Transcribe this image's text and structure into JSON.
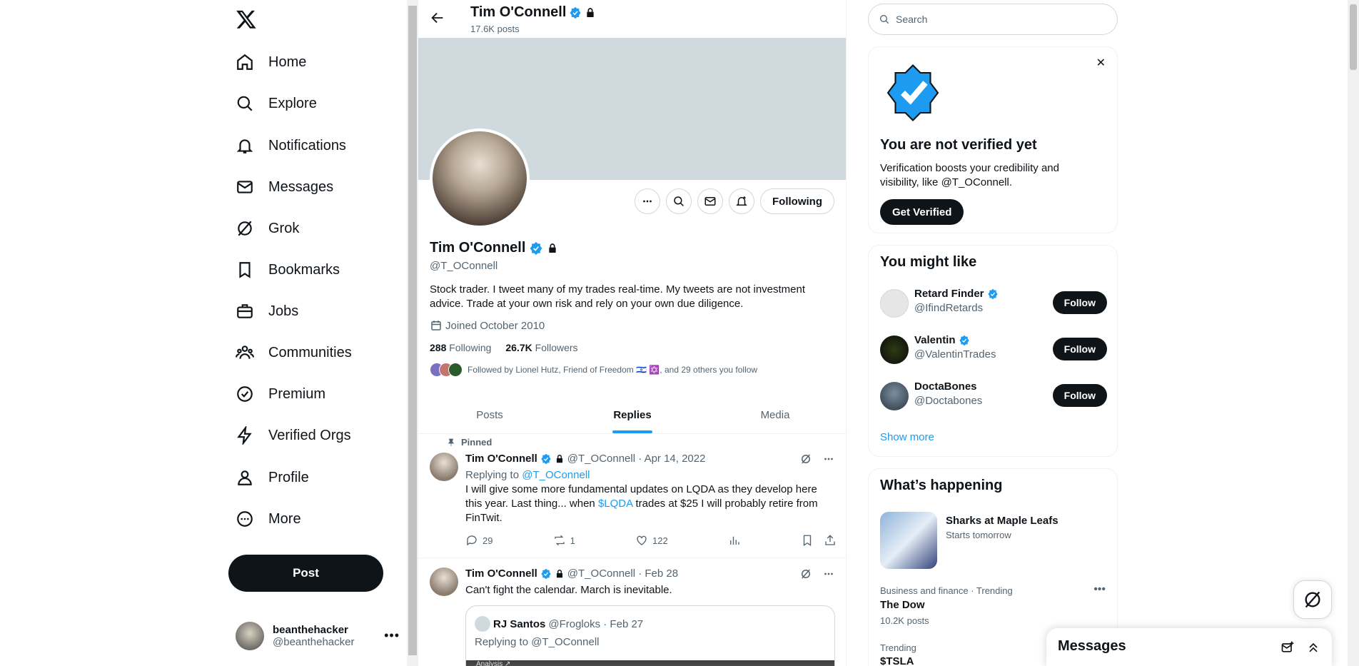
{
  "nav": {
    "items": [
      {
        "label": "Home"
      },
      {
        "label": "Explore"
      },
      {
        "label": "Notifications"
      },
      {
        "label": "Messages"
      },
      {
        "label": "Grok"
      },
      {
        "label": "Bookmarks"
      },
      {
        "label": "Jobs"
      },
      {
        "label": "Communities"
      },
      {
        "label": "Premium"
      },
      {
        "label": "Verified Orgs"
      },
      {
        "label": "Profile"
      },
      {
        "label": "More"
      }
    ],
    "post_label": "Post",
    "account": {
      "name": "beanthehacker",
      "handle": "@beanthehacker"
    }
  },
  "header": {
    "name": "Tim O'Connell",
    "posts": "17.6K posts"
  },
  "profile": {
    "name": "Tim O'Connell",
    "handle": "@T_OConnell",
    "bio": "Stock trader.  I tweet many of my trades real-time.  My tweets are not investment advice.  Trade at your own risk and rely on your own due diligence.",
    "joined": "Joined October 2010",
    "following_count": "288",
    "following_label": "Following",
    "followers_count": "26.7K",
    "followers_label": "Followers",
    "followed_by": "Followed by Lionel Hutz, Friend of Freedom 🇮🇱 ✡️, and 29 others you follow",
    "following_button": "Following"
  },
  "tabs": [
    {
      "label": "Posts"
    },
    {
      "label": "Replies"
    },
    {
      "label": "Media"
    }
  ],
  "tweets": [
    {
      "pinned": "Pinned",
      "name": "Tim O'Connell",
      "meta": "@T_OConnell · Apr 14, 2022",
      "reply_prefix": "Replying to ",
      "reply_to": "@T_OConnell",
      "text_a": "I will give some more fundamental updates on LQDA as they develop here this year.  Last thing... when ",
      "cashtag": "$LQDA",
      "text_b": " trades at $25 I will probably retire from FinTwit.",
      "replies": "29",
      "reposts": "1",
      "likes": "122"
    },
    {
      "name": "Tim O'Connell",
      "meta": "@T_OConnell · Feb 28",
      "text": "Can't fight the calendar.  March is inevitable.",
      "quote": {
        "name": "RJ Santos",
        "meta": "@Frogloks · Feb 27",
        "reply": "Replying to @T_OConnell",
        "img_caption": "Analysis ↗"
      }
    }
  ],
  "sidebar": {
    "search_placeholder": "Search",
    "verify": {
      "title": "You are not verified yet",
      "text": "Verification boosts your credibility and visibility, like @T_OConnell.",
      "button": "Get Verified"
    },
    "might_like": {
      "title": "You might like",
      "users": [
        {
          "name": "Retard Finder",
          "handle": "@IfindRetards",
          "verified": true
        },
        {
          "name": "Valentin",
          "handle": "@ValentinTrades",
          "verified": true
        },
        {
          "name": "DoctaBones",
          "handle": "@Doctabones",
          "verified": false
        }
      ],
      "follow_label": "Follow",
      "show_more": "Show more"
    },
    "happening": {
      "title": "What’s happening",
      "event_title": "Sharks at Maple Leafs",
      "event_sub": "Starts tomorrow",
      "trends": [
        {
          "category": "Business and finance · Trending",
          "name": "The Dow",
          "posts": "10.2K posts"
        },
        {
          "category": "Trending",
          "name": "$TSLA",
          "posts": ""
        }
      ]
    }
  },
  "messages_drawer": {
    "title": "Messages"
  },
  "colors": {
    "accent": "#1d9bf0",
    "text": "#0f1419",
    "muted": "#536471",
    "dark_button": "#0f1419"
  }
}
